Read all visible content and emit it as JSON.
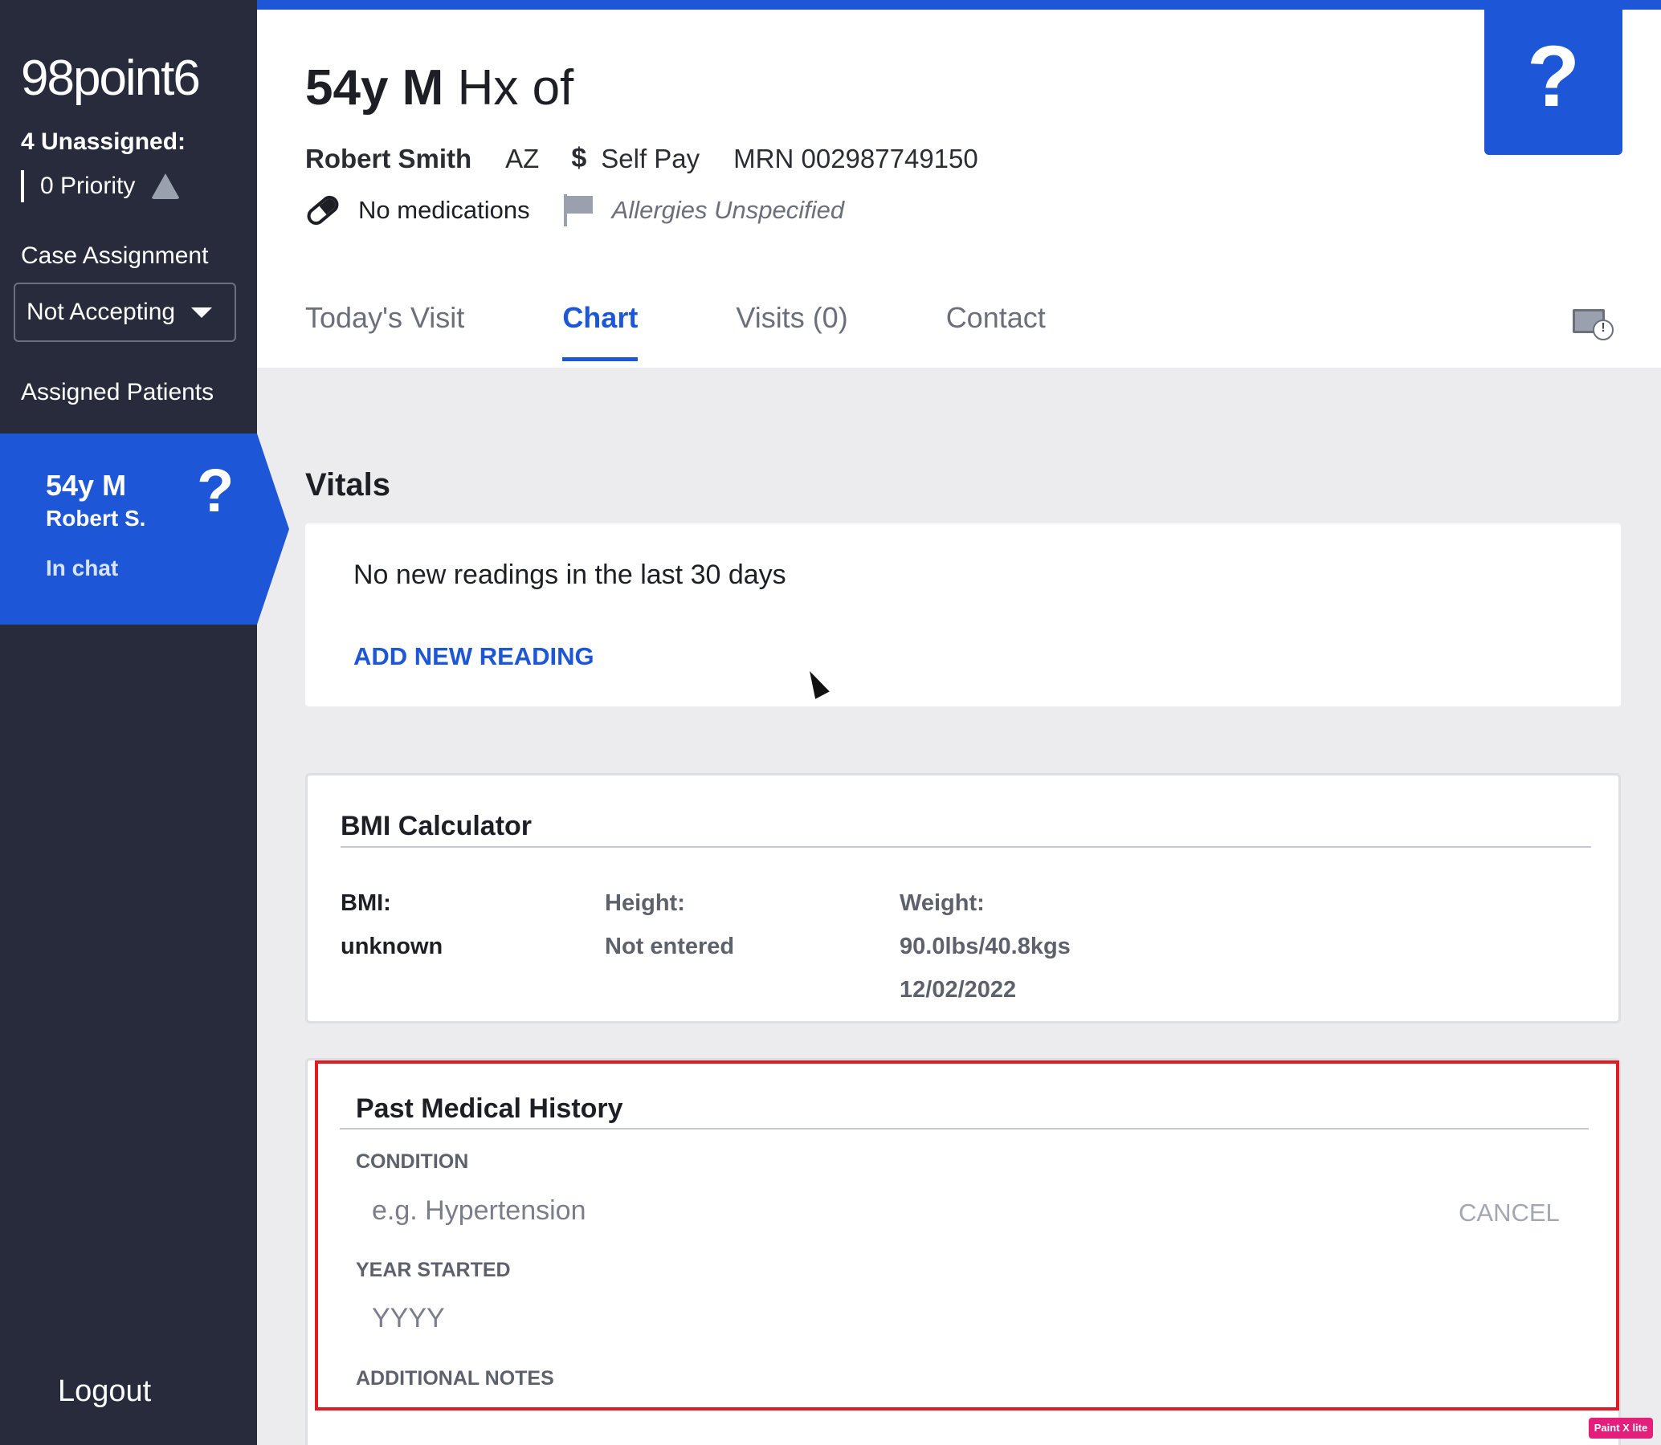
{
  "sidebar": {
    "logo": "98point6",
    "unassigned": "4 Unassigned:",
    "priority": "0 Priority",
    "case_assignment_label": "Case Assignment",
    "case_assignment_value": "Not Accepting",
    "assigned_patients_label": "Assigned Patients",
    "patient_card": {
      "age_sex": "54y M",
      "name": "Robert S.",
      "status": "In chat",
      "help_glyph": "?"
    },
    "logout": "Logout"
  },
  "header": {
    "help_glyph": "?",
    "title_bold": "54y M",
    "title_rest": "Hx of",
    "patient_name": "Robert Smith",
    "state": "AZ",
    "payment_symbol": "$",
    "payment": "Self Pay",
    "mrn": "MRN 002987749150",
    "medications": "No medications",
    "allergies": "Allergies Unspecified"
  },
  "tabs": [
    {
      "label": "Today's Visit"
    },
    {
      "label": "Chart"
    },
    {
      "label": "Visits (0)"
    },
    {
      "label": "Contact"
    }
  ],
  "vitals": {
    "title": "Vitals",
    "message": "No new readings in the last 30 days",
    "add_label": "ADD NEW READING"
  },
  "bmi": {
    "title": "BMI Calculator",
    "bmi_label": "BMI:",
    "bmi_value": "unknown",
    "height_label": "Height:",
    "height_value": "Not entered",
    "weight_label": "Weight:",
    "weight_value": "90.0lbs/40.8kgs",
    "weight_date": "12/02/2022"
  },
  "pmh": {
    "title": "Past Medical History",
    "condition_label": "CONDITION",
    "condition_placeholder": "e.g. Hypertension",
    "cancel_label": "CANCEL",
    "year_label": "YEAR STARTED",
    "year_placeholder": "YYYY",
    "notes_label": "ADDITIONAL NOTES"
  },
  "watermark": "Paint X lite",
  "colors": {
    "sidebar_bg": "#272b3c",
    "accent_blue": "#1d56d6",
    "highlight_red": "#e01b24"
  }
}
